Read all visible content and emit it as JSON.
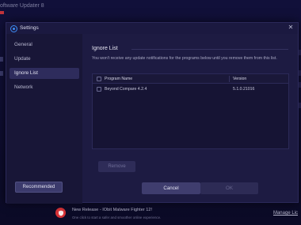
{
  "background": {
    "app_title": "oftware Updater 8",
    "notification": {
      "title": "New Release - IObit Malware Fighter 12!",
      "subtitle": "One click to start a safer and smoother online experience.",
      "link": "Manage Lic"
    }
  },
  "dialog": {
    "title": "Settings",
    "close_icon": "close-icon"
  },
  "sidebar": {
    "items": [
      {
        "label": "General",
        "active": false
      },
      {
        "label": "Update",
        "active": false
      },
      {
        "label": "Ignore List",
        "active": true
      },
      {
        "label": "Network",
        "active": false
      }
    ],
    "recommended_label": "Recommended"
  },
  "content": {
    "section_title": "Ignore List",
    "description": "You won't receive any update notifications for the programs below until you remove them from this list.",
    "table": {
      "columns": [
        "Program Name",
        "Version"
      ],
      "rows": [
        {
          "name": "Beyond Compare 4.2.4",
          "version": "5.1.0.21016",
          "checked": false
        }
      ]
    },
    "remove_label": "Remove",
    "cancel_label": "Cancel",
    "ok_label": "OK"
  },
  "colors": {
    "background": "#0d0c2a",
    "dialog": "#1d1b42",
    "sidebar": "#181637",
    "accent_blue": "#3d8df5",
    "notify_red": "#d73338"
  }
}
